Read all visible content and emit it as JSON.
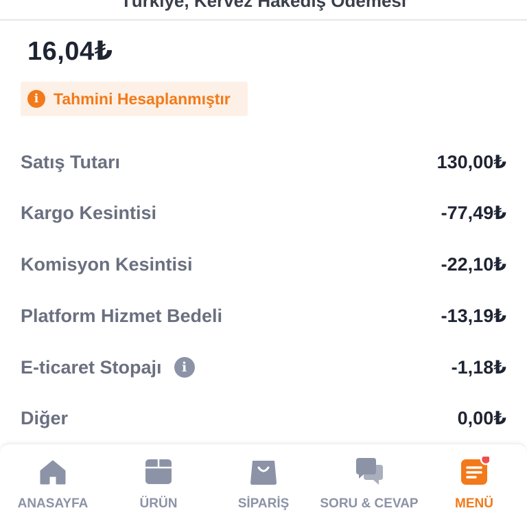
{
  "header": {
    "title": "Türkiye, Kervez Hakedış Ödemesi"
  },
  "summary": {
    "amount": "16,04₺",
    "notice": "Tahmini Hesaplanmıştır"
  },
  "rows": [
    {
      "label": "Satış Tutarı",
      "value": "130,00₺"
    },
    {
      "label": "Kargo Kesintisi",
      "value": "-77,49₺"
    },
    {
      "label": "Komisyon Kesintisi",
      "value": "-22,10₺"
    },
    {
      "label": "Platform Hizmet Bedeli",
      "value": "-13,19₺"
    },
    {
      "label": "E-ticaret Stopajı",
      "value": "-1,18₺"
    },
    {
      "label": "Diğer",
      "value": "0,00₺"
    }
  ],
  "nav": {
    "items": [
      {
        "label": "ANASAYFA",
        "icon": "home-icon"
      },
      {
        "label": "ÜRÜN",
        "icon": "box-icon"
      },
      {
        "label": "SİPARİŞ",
        "icon": "bag-icon"
      },
      {
        "label": "SORU & CEVAP",
        "icon": "chat-icon"
      },
      {
        "label": "MENÜ",
        "icon": "menu-icon"
      }
    ],
    "active": "MENÜ"
  },
  "colors": {
    "accent": "#f27a1a",
    "notice_bg": "#fdf0e6",
    "label_gray": "#6b7080",
    "icon_gray": "#8c93a6",
    "badge_red": "#f04e4e"
  }
}
